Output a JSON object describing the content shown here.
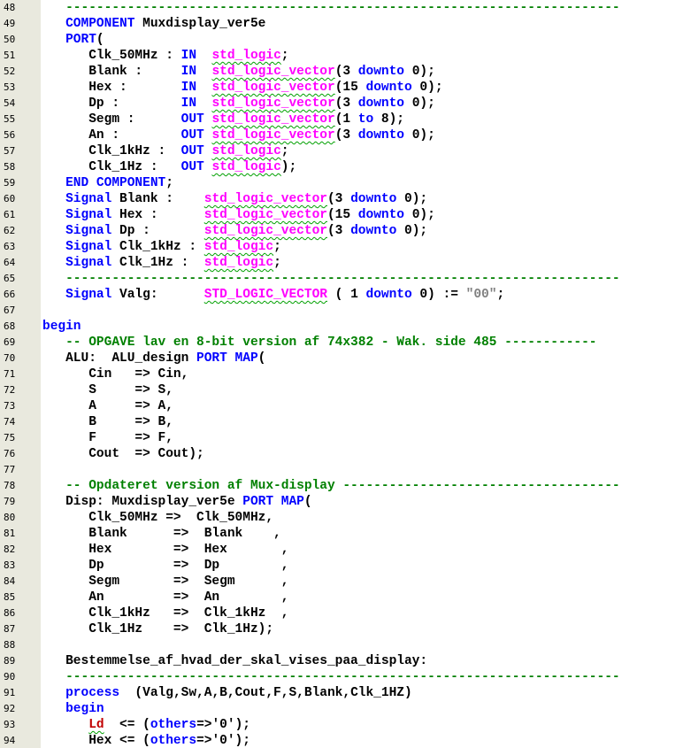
{
  "editor": {
    "colors": {
      "keyword": "#0000ff",
      "type": "#ff00ff",
      "comment": "#008000",
      "string": "#808080",
      "signal_red": "#c00000",
      "gutter": "#e9e9de"
    },
    "lines": [
      {
        "n": "48",
        "tokens": [
          [
            "   ",
            "plain"
          ],
          [
            "------------------------------------------------------------------------",
            "com"
          ]
        ]
      },
      {
        "n": "49",
        "tokens": [
          [
            "   ",
            "plain"
          ],
          [
            "COMPONENT",
            "kw"
          ],
          [
            " Muxdisplay_ver5e",
            "plain"
          ]
        ]
      },
      {
        "n": "50",
        "tokens": [
          [
            "   ",
            "plain"
          ],
          [
            "PORT",
            "kw"
          ],
          [
            "(",
            "plain"
          ]
        ]
      },
      {
        "n": "51",
        "tokens": [
          [
            "      Clk_50MHz : ",
            "plain"
          ],
          [
            "IN",
            "kw"
          ],
          [
            "  ",
            "plain"
          ],
          [
            "std_logic",
            "type"
          ],
          [
            ";",
            "plain"
          ]
        ]
      },
      {
        "n": "52",
        "tokens": [
          [
            "      Blank :     ",
            "plain"
          ],
          [
            "IN",
            "kw"
          ],
          [
            "  ",
            "plain"
          ],
          [
            "std_logic_vector",
            "type"
          ],
          [
            "(3 ",
            "plain"
          ],
          [
            "downto",
            "kw"
          ],
          [
            " 0);",
            "plain"
          ]
        ]
      },
      {
        "n": "53",
        "tokens": [
          [
            "      Hex :       ",
            "plain"
          ],
          [
            "IN",
            "kw"
          ],
          [
            "  ",
            "plain"
          ],
          [
            "std_logic_vector",
            "type"
          ],
          [
            "(15 ",
            "plain"
          ],
          [
            "downto",
            "kw"
          ],
          [
            " 0);",
            "plain"
          ]
        ]
      },
      {
        "n": "54",
        "tokens": [
          [
            "      Dp :        ",
            "plain"
          ],
          [
            "IN",
            "kw"
          ],
          [
            "  ",
            "plain"
          ],
          [
            "std_logic_vector",
            "type"
          ],
          [
            "(3 ",
            "plain"
          ],
          [
            "downto",
            "kw"
          ],
          [
            " 0);",
            "plain"
          ]
        ]
      },
      {
        "n": "55",
        "tokens": [
          [
            "      Segm :      ",
            "plain"
          ],
          [
            "OUT",
            "kw"
          ],
          [
            " ",
            "plain"
          ],
          [
            "std_logic_vector",
            "type"
          ],
          [
            "(1 ",
            "plain"
          ],
          [
            "to",
            "kw"
          ],
          [
            " 8);",
            "plain"
          ]
        ]
      },
      {
        "n": "56",
        "tokens": [
          [
            "      An :        ",
            "plain"
          ],
          [
            "OUT",
            "kw"
          ],
          [
            " ",
            "plain"
          ],
          [
            "std_logic_vector",
            "type"
          ],
          [
            "(3 ",
            "plain"
          ],
          [
            "downto",
            "kw"
          ],
          [
            " 0);",
            "plain"
          ]
        ]
      },
      {
        "n": "57",
        "tokens": [
          [
            "      Clk_1kHz :  ",
            "plain"
          ],
          [
            "OUT",
            "kw"
          ],
          [
            " ",
            "plain"
          ],
          [
            "std_logic",
            "type"
          ],
          [
            ";",
            "plain"
          ]
        ]
      },
      {
        "n": "58",
        "tokens": [
          [
            "      Clk_1Hz :   ",
            "plain"
          ],
          [
            "OUT",
            "kw"
          ],
          [
            " ",
            "plain"
          ],
          [
            "std_logic",
            "type"
          ],
          [
            ");",
            "plain"
          ]
        ]
      },
      {
        "n": "59",
        "tokens": [
          [
            "   ",
            "plain"
          ],
          [
            "END",
            "kw"
          ],
          [
            " ",
            "plain"
          ],
          [
            "COMPONENT",
            "kw"
          ],
          [
            ";",
            "plain"
          ]
        ]
      },
      {
        "n": "60",
        "tokens": [
          [
            "   ",
            "plain"
          ],
          [
            "Signal",
            "kw"
          ],
          [
            " Blank :    ",
            "plain"
          ],
          [
            "std_logic_vector",
            "type"
          ],
          [
            "(3 ",
            "plain"
          ],
          [
            "downto",
            "kw"
          ],
          [
            " 0);",
            "plain"
          ]
        ]
      },
      {
        "n": "61",
        "tokens": [
          [
            "   ",
            "plain"
          ],
          [
            "Signal",
            "kw"
          ],
          [
            " Hex :      ",
            "plain"
          ],
          [
            "std_logic_vector",
            "type"
          ],
          [
            "(15 ",
            "plain"
          ],
          [
            "downto",
            "kw"
          ],
          [
            " 0);",
            "plain"
          ]
        ]
      },
      {
        "n": "62",
        "tokens": [
          [
            "   ",
            "plain"
          ],
          [
            "Signal",
            "kw"
          ],
          [
            " Dp :       ",
            "plain"
          ],
          [
            "std_logic_vector",
            "type"
          ],
          [
            "(3 ",
            "plain"
          ],
          [
            "downto",
            "kw"
          ],
          [
            " 0);",
            "plain"
          ]
        ]
      },
      {
        "n": "63",
        "tokens": [
          [
            "   ",
            "plain"
          ],
          [
            "Signal",
            "kw"
          ],
          [
            " Clk_1kHz : ",
            "plain"
          ],
          [
            "std_logic",
            "type"
          ],
          [
            ";",
            "plain"
          ]
        ]
      },
      {
        "n": "64",
        "tokens": [
          [
            "   ",
            "plain"
          ],
          [
            "Signal",
            "kw"
          ],
          [
            " Clk_1Hz :  ",
            "plain"
          ],
          [
            "std_logic",
            "type"
          ],
          [
            ";",
            "plain"
          ]
        ]
      },
      {
        "n": "65",
        "tokens": [
          [
            "   ",
            "plain"
          ],
          [
            "------------------------------------------------------------------------",
            "com"
          ]
        ]
      },
      {
        "n": "66",
        "tokens": [
          [
            "   ",
            "plain"
          ],
          [
            "Signal",
            "kw"
          ],
          [
            " Valg:      ",
            "plain"
          ],
          [
            "STD_LOGIC_VECTOR",
            "type"
          ],
          [
            " ( 1 ",
            "plain"
          ],
          [
            "downto",
            "kw"
          ],
          [
            " 0) := ",
            "plain"
          ],
          [
            "\"00\"",
            "str"
          ],
          [
            ";",
            "plain"
          ]
        ]
      },
      {
        "n": "67",
        "tokens": []
      },
      {
        "n": "68",
        "tokens": [
          [
            "begin",
            "kw"
          ]
        ]
      },
      {
        "n": "69",
        "tokens": [
          [
            "   ",
            "plain"
          ],
          [
            "-- OPGAVE lav en 8-bit version af 74x382 - Wak. side 485 ------------",
            "com"
          ]
        ]
      },
      {
        "n": "70",
        "tokens": [
          [
            "   ALU:  ALU_design ",
            "plain"
          ],
          [
            "PORT",
            "kw"
          ],
          [
            " ",
            "plain"
          ],
          [
            "MAP",
            "kw"
          ],
          [
            "(",
            "plain"
          ]
        ]
      },
      {
        "n": "71",
        "tokens": [
          [
            "      Cin   => Cin,",
            "plain"
          ]
        ]
      },
      {
        "n": "72",
        "tokens": [
          [
            "      S     => S,",
            "plain"
          ]
        ]
      },
      {
        "n": "73",
        "tokens": [
          [
            "      A     => A,",
            "plain"
          ]
        ]
      },
      {
        "n": "74",
        "tokens": [
          [
            "      B     => B,",
            "plain"
          ]
        ]
      },
      {
        "n": "75",
        "tokens": [
          [
            "      F     => F,",
            "plain"
          ]
        ]
      },
      {
        "n": "76",
        "tokens": [
          [
            "      Cout  => Cout);",
            "plain"
          ]
        ]
      },
      {
        "n": "77",
        "tokens": []
      },
      {
        "n": "78",
        "tokens": [
          [
            "   ",
            "plain"
          ],
          [
            "-- Opdateret version af Mux-display ------------------------------------",
            "com"
          ]
        ]
      },
      {
        "n": "79",
        "tokens": [
          [
            "   Disp: Muxdisplay_ver5e ",
            "plain"
          ],
          [
            "PORT",
            "kw"
          ],
          [
            " ",
            "plain"
          ],
          [
            "MAP",
            "kw"
          ],
          [
            "(",
            "plain"
          ]
        ]
      },
      {
        "n": "80",
        "tokens": [
          [
            "      Clk_50MHz =>  Clk_50MHz,",
            "plain"
          ]
        ]
      },
      {
        "n": "81",
        "tokens": [
          [
            "      Blank      =>  Blank    ,",
            "plain"
          ]
        ]
      },
      {
        "n": "82",
        "tokens": [
          [
            "      Hex        =>  Hex       ,",
            "plain"
          ]
        ]
      },
      {
        "n": "83",
        "tokens": [
          [
            "      Dp         =>  Dp        ,",
            "plain"
          ]
        ]
      },
      {
        "n": "84",
        "tokens": [
          [
            "      Segm       =>  Segm      ,",
            "plain"
          ]
        ]
      },
      {
        "n": "85",
        "tokens": [
          [
            "      An         =>  An        ,",
            "plain"
          ]
        ]
      },
      {
        "n": "86",
        "tokens": [
          [
            "      Clk_1kHz   =>  Clk_1kHz  ,",
            "plain"
          ]
        ]
      },
      {
        "n": "87",
        "tokens": [
          [
            "      Clk_1Hz    =>  Clk_1Hz);",
            "plain"
          ]
        ]
      },
      {
        "n": "88",
        "tokens": []
      },
      {
        "n": "89",
        "tokens": [
          [
            "   Bestemmelse_af_hvad_der_skal_vises_paa_display:",
            "plain"
          ]
        ]
      },
      {
        "n": "90",
        "tokens": [
          [
            "   ",
            "plain"
          ],
          [
            "------------------------------------------------------------------------",
            "com"
          ]
        ]
      },
      {
        "n": "91",
        "tokens": [
          [
            "   ",
            "plain"
          ],
          [
            "process",
            "kw"
          ],
          [
            "  (Valg,Sw,A,B,Cout,F,S,Blank,Clk_1HZ)",
            "plain"
          ]
        ]
      },
      {
        "n": "92",
        "tokens": [
          [
            "   ",
            "plain"
          ],
          [
            "begin",
            "kw"
          ]
        ]
      },
      {
        "n": "93",
        "tokens": [
          [
            "      ",
            "plain"
          ],
          [
            "Ld",
            "red"
          ],
          [
            "  <= (",
            "plain"
          ],
          [
            "others",
            "kw"
          ],
          [
            "=>'0');",
            "plain"
          ]
        ]
      },
      {
        "n": "94",
        "tokens": [
          [
            "      Hex <= (",
            "plain"
          ],
          [
            "others",
            "kw"
          ],
          [
            "=>'0');",
            "plain"
          ]
        ]
      }
    ]
  }
}
